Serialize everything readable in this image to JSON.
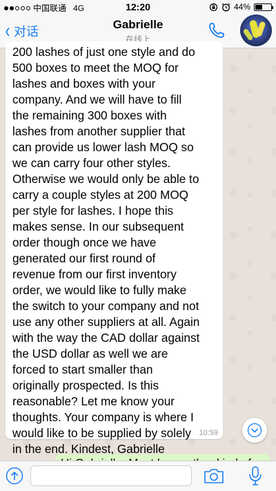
{
  "status_bar": {
    "carrier": "中国联通",
    "network": "4G",
    "time": "12:20",
    "battery": "44%",
    "battery_level": 0.44
  },
  "header": {
    "back_label": "对话",
    "contact_name": "Gabrielle",
    "contact_status": "在线上"
  },
  "message": {
    "text": "200 lashes of just one style and do\n500 boxes to meet the MOQ for\nlashes and boxes with your\ncompany. And we will have to fill\nthe remaining 300 boxes with\nlashes from another supplier that\ncan provide us lower lash MOQ so\nwe can carry four other styles.\nOtherwise we would only be able to\ncarry a couple styles at 200 MOQ\nper style for lashes. I hope this\nmakes sense. In our subsequent\norder though once we have\ngenerated our first round of\nrevenue from our first inventory\norder, we would like to fully make\nthe switch to your company and not\nuse any other suppliers at all. Again\nwith the way the CAD dollar against\nthe USD dollar as well we are\nforced to start smaller than\noriginally prospected. Is this\nreasonable? Let me know your\nthoughts. Your company is where I\nwould like to be supplied by solely\nin the end. Kindest, Gabrielle",
    "time": "10:59"
  },
  "outgoing_preview": {
    "text": "Hi Gabrielle. Must be another kind of"
  },
  "input": {
    "placeholder": "",
    "value": ""
  },
  "colors": {
    "accent": "#1a7ff0",
    "outgoing_bubble": "#dcf8c6"
  }
}
